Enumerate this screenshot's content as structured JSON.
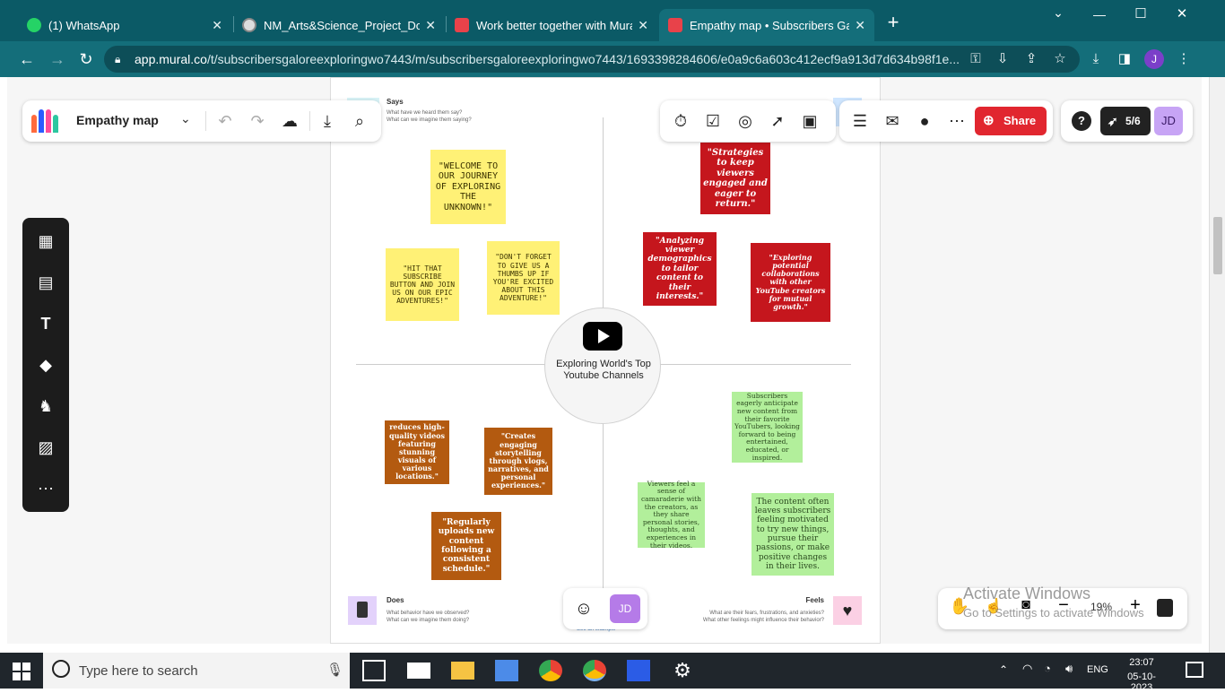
{
  "browser": {
    "tabs": [
      {
        "title": "(1) WhatsApp",
        "close": "✕"
      },
      {
        "title": "NM_Arts&Science_Project_Docum",
        "close": "✕"
      },
      {
        "title": "Work better together with Mural",
        "close": "✕"
      },
      {
        "title": "Empathy map • Subscribers Galo",
        "close": "✕"
      }
    ],
    "new_tab": "+",
    "url_host": "app.mural.co",
    "url_path": "/t/subscribersgaloreexploringwo7443/m/subscribersgaloreexploringwo7443/1693398284606/e0a9c6a603c412ecf9a913d7d634b98f1e...",
    "profile_initial": "J",
    "window_controls": {
      "minimize": "—",
      "maximize": "☐",
      "close": "✕",
      "chevron": "⌄"
    }
  },
  "toolbar": {
    "board_title": "Empathy map",
    "presence_count": "5/6",
    "share_label": "Share",
    "user_initials": "JD",
    "help": "?"
  },
  "map": {
    "says_title": "Says",
    "says_sub1": "What have we heard them say?",
    "says_sub2": "What can we imagine them saying?",
    "does_title": "Does",
    "does_sub1": "What behavior have we observed?",
    "does_sub2": "What can we imagine them doing?",
    "feels_title": "Feels",
    "feels_sub1": "What are their fears, frustrations, and anxieties?",
    "feels_sub2": "What other feelings might influence their behavior?",
    "center_label": "Exploring World's Top Youtube Channels",
    "see_example": "See an example"
  },
  "stickies": {
    "says": [
      "\"WELCOME TO OUR JOURNEY OF EXPLORING THE UNKNOWN!\"",
      "\"HIT THAT SUBSCRIBE BUTTON AND JOIN US ON OUR EPIC ADVENTURES!\"",
      "\"DON'T FORGET TO GIVE US A THUMBS UP IF YOU'RE EXCITED ABOUT THIS ADVENTURE!\""
    ],
    "thinks": [
      "\"Strategies to keep viewers engaged and eager to return.\"",
      "\"Analyzing viewer demographics to tailor content to their interests.\"",
      "\"Exploring potential collaborations with other YouTube creators for mutual growth.\""
    ],
    "does": [
      "reduces high-quality videos featuring stunning visuals of various locations.\"",
      "\"Creates engaging storytelling through vlogs, narratives, and personal experiences.\"",
      "\"Regularly uploads new content following a consistent schedule.\""
    ],
    "feels": [
      "Subscribers eagerly anticipate new content from their favorite YouTubers, looking forward to being entertained, educated, or inspired.",
      "Viewers feel a sense of camaraderie with the creators, as they share personal stories, thoughts, and experiences in their videos.",
      "The content often leaves subscribers feeling motivated to try new things, pursue their passions, or make positive changes in their lives."
    ]
  },
  "bottom": {
    "user_initials": "JD",
    "zoom": "19%",
    "activate_title": "Activate Windows",
    "activate_sub": "Go to Settings to activate Windows"
  },
  "taskbar": {
    "search_placeholder": "Type here to search",
    "lang": "ENG",
    "time": "23:07",
    "date": "05-10-2023"
  },
  "colors": {
    "chrome_tab": "#0b5a66",
    "chrome_bar": "#146e7a",
    "share_red": "#e1262f",
    "sticky_yellow": "#fff176",
    "sticky_red": "#c5161d",
    "sticky_orange": "#b35a10",
    "sticky_green": "#b2ef9b"
  }
}
